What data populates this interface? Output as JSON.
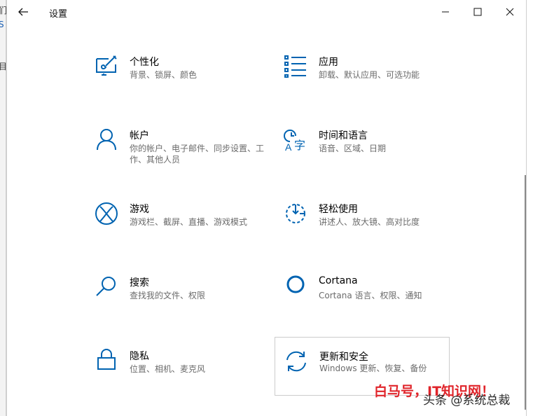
{
  "window": {
    "title": "设置"
  },
  "behind": {
    "fragments": [
      "们",
      "S",
      "目"
    ]
  },
  "tiles": [
    {
      "label": "个性化",
      "desc": "背景、锁屏、颜色"
    },
    {
      "label": "应用",
      "desc": "卸载、默认应用、可选功能"
    },
    {
      "label": "帐户",
      "desc": "你的帐户、电子邮件、同步设置、工作、其他人员"
    },
    {
      "label": "时间和语言",
      "desc": "语音、区域、日期"
    },
    {
      "label": "游戏",
      "desc": "游戏栏、截屏、直播、游戏模式"
    },
    {
      "label": "轻松使用",
      "desc": "讲述人、放大镜、高对比度"
    },
    {
      "label": "搜索",
      "desc": "查找我的文件、权限"
    },
    {
      "label": "Cortana",
      "desc": "Cortana 语言、权限、通知"
    },
    {
      "label": "隐私",
      "desc": "位置、相机、麦克风"
    },
    {
      "label": "更新和安全",
      "desc": "Windows 更新、恢复、备份"
    }
  ],
  "watermark": {
    "brand": "白马号，IT知识网！",
    "source": "头条 @系统总裁"
  },
  "colors": {
    "accent": "#0063b1",
    "desc_text": "#6b6b6b"
  },
  "icons": [
    "back-arrow-icon",
    "minimize-icon",
    "maximize-icon",
    "close-icon",
    "personalization-icon",
    "apps-icon",
    "account-icon",
    "time-language-icon",
    "gaming-icon",
    "ease-of-access-icon",
    "search-icon",
    "cortana-icon",
    "privacy-lock-icon",
    "update-sync-icon"
  ]
}
